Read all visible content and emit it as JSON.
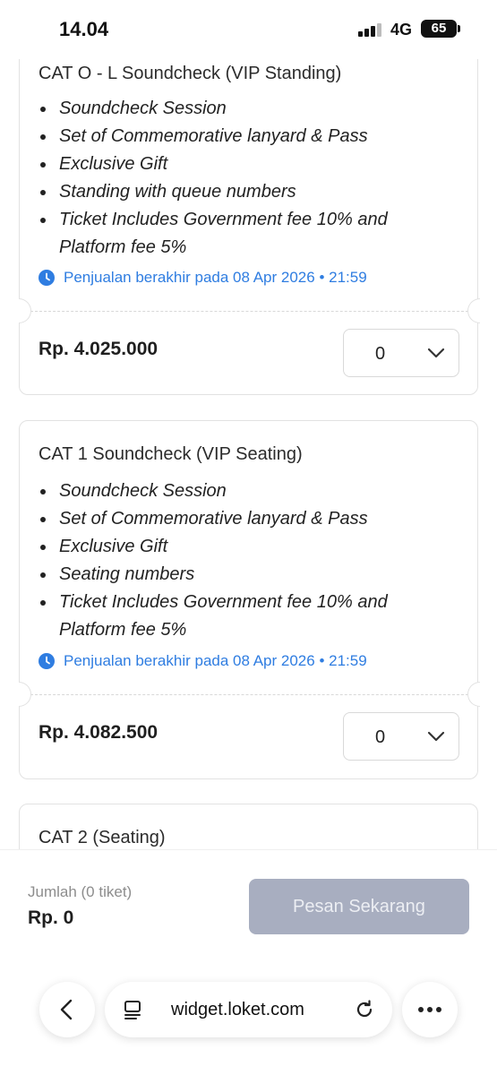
{
  "status_bar": {
    "time": "14.04",
    "network": "4G",
    "battery": "65"
  },
  "tickets": [
    {
      "title": "CAT O - L Soundcheck (VIP Standing)",
      "benefits": [
        "Soundcheck Session",
        "Set of Commemorative lanyard & Pass",
        "Exclusive Gift",
        "Standing with queue numbers",
        "Ticket Includes Government fee 10% and Platform fee 5%"
      ],
      "deadline": "Penjualan berakhir pada 08 Apr 2026 • 21:59",
      "price": "Rp. 4.025.000",
      "quantity": "0"
    },
    {
      "title": "CAT 1 Soundcheck (VIP Seating)",
      "benefits": [
        "Soundcheck Session",
        "Set of Commemorative lanyard & Pass",
        "Exclusive Gift",
        "Seating numbers",
        "Ticket Includes Government fee 10% and Platform fee 5%"
      ],
      "deadline": "Penjualan berakhir pada 08 Apr 2026 • 21:59",
      "price": "Rp. 4.082.500",
      "quantity": "0"
    },
    {
      "title": "CAT 2 (Seating)"
    }
  ],
  "summary": {
    "label": "Jumlah (0 tiket)",
    "total": "Rp. 0",
    "order_button": "Pesan Sekarang"
  },
  "browser": {
    "url": "widget.loket.com"
  },
  "colors": {
    "accent_blue": "#2f7de1",
    "disabled_button": "#a8aec0"
  }
}
